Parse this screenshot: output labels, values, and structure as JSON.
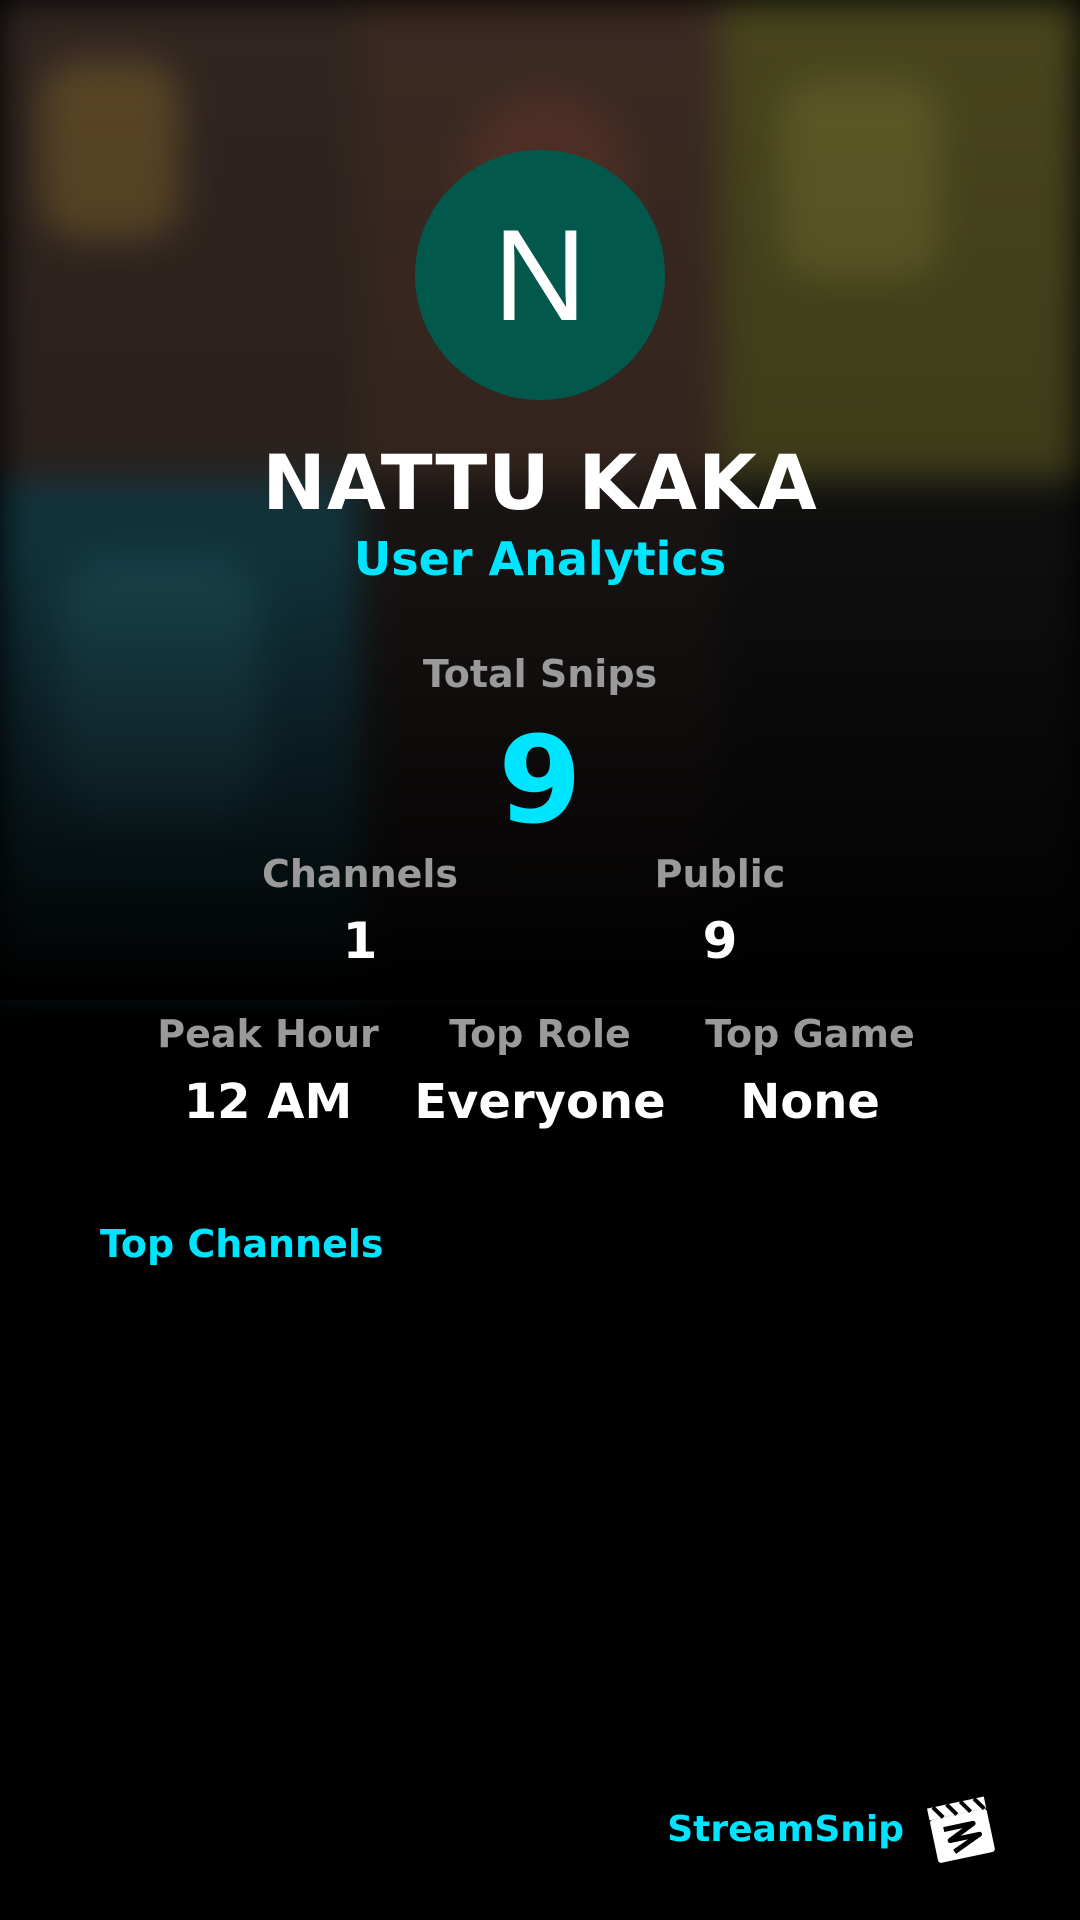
{
  "profile": {
    "initial": "N",
    "name": "NATTU KAKA",
    "subtitle": "User Analytics",
    "avatar_color": "#02594b"
  },
  "stats": {
    "total_snips_label": "Total Snips",
    "total_snips_value": "9",
    "channels_label": "Channels",
    "channels_value": "1",
    "public_label": "Public",
    "public_value": "9",
    "peak_hour_label": "Peak Hour",
    "peak_hour_value": "12 AM",
    "top_role_label": "Top Role",
    "top_role_value": "Everyone",
    "top_game_label": "Top Game",
    "top_game_value": "None"
  },
  "top_channels": {
    "title": "Top Channels"
  },
  "brand": {
    "name": "StreamSnip",
    "logo_icon": "clapperboard-icon"
  },
  "colors": {
    "accent": "#00e5ff",
    "label_gray": "#9a9a9a",
    "background": "#000000"
  }
}
